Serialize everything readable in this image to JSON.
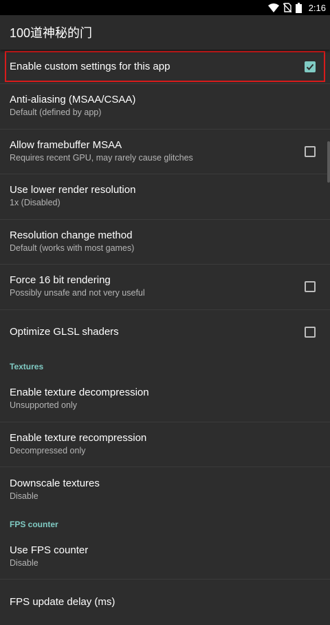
{
  "status": {
    "time": "2:16"
  },
  "app_title": "100道神秘的门",
  "items": [
    {
      "title": "Enable custom settings for this app",
      "checkbox": true,
      "checked": true
    },
    {
      "title": "Anti-aliasing (MSAA/CSAA)",
      "summary": "Default (defined by app)"
    },
    {
      "title": "Allow framebuffer MSAA",
      "summary": "Requires recent GPU, may rarely cause glitches",
      "checkbox": true,
      "checked": false
    },
    {
      "title": "Use lower render resolution",
      "summary": "1x (Disabled)"
    },
    {
      "title": "Resolution change method",
      "summary": "Default (works with most games)"
    },
    {
      "title": "Force 16 bit rendering",
      "summary": "Possibly unsafe and not very useful",
      "checkbox": true,
      "checked": false
    },
    {
      "title": "Optimize GLSL shaders",
      "checkbox": true,
      "checked": false
    }
  ],
  "textures": {
    "header": "Textures",
    "items": [
      {
        "title": "Enable texture decompression",
        "summary": "Unsupported only"
      },
      {
        "title": "Enable texture recompression",
        "summary": "Decompressed only"
      },
      {
        "title": "Downscale textures",
        "summary": "Disable"
      }
    ]
  },
  "fps": {
    "header": "FPS counter",
    "items": [
      {
        "title": "Use FPS counter",
        "summary": "Disable"
      },
      {
        "title": "FPS update delay (ms)"
      }
    ]
  },
  "colors": {
    "accent": "#80cbc4",
    "highlight": "#d81b1b",
    "background": "#2d2d2d"
  },
  "icons": [
    "wifi-icon",
    "no-sim-icon",
    "battery-icon",
    "checkbox-icon"
  ]
}
